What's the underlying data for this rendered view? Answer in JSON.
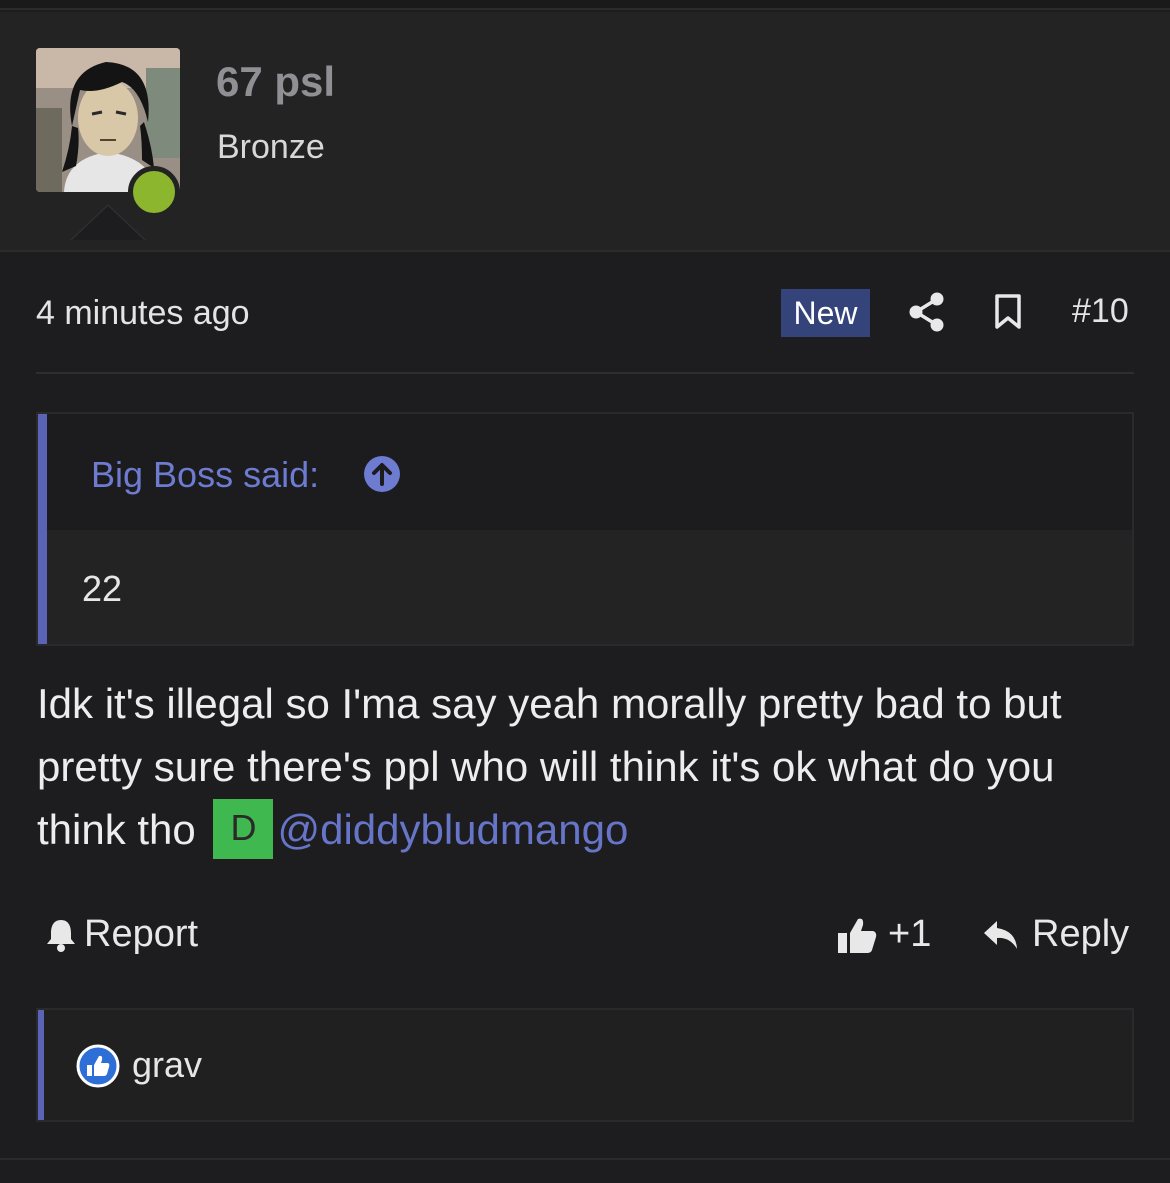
{
  "user": {
    "name": "67 psl",
    "title": "Bronze",
    "online_color": "#8bb62e"
  },
  "post": {
    "time": "4 minutes ago",
    "badge": "New",
    "number": "#10",
    "body_text": "Idk it's illegal so I'ma say yeah morally pretty bad to but pretty sure there's ppl who will think it's ok what do you think tho",
    "mention_avatar_letter": "D",
    "mention": "@diddybludmango"
  },
  "quote": {
    "author": "Big Boss said:",
    "text": "22"
  },
  "actions": {
    "report": "Report",
    "like_count": "+1",
    "reply": "Reply"
  },
  "reactions": {
    "users": "grav"
  },
  "colors": {
    "accent": "#5a63b6",
    "badge_bg": "#34437a",
    "mention_green": "#3fb94f"
  }
}
